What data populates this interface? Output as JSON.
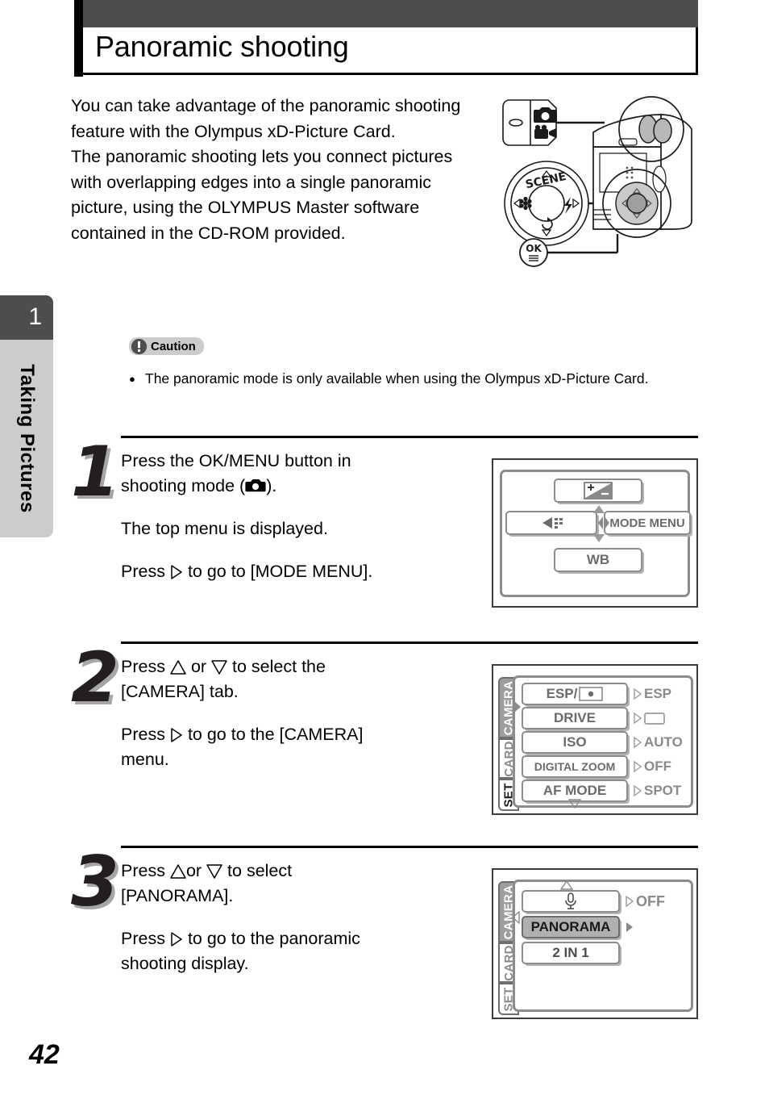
{
  "header": {
    "title": "Panoramic shooting"
  },
  "chapter_tab": {
    "number": "1",
    "name": "Taking Pictures"
  },
  "intro": {
    "paragraph": "You can take advantage of the panoramic shooting feature with the Olympus xD-Picture Card.\nThe panoramic shooting lets you connect pictures with overlapping edges into a single panoramic picture, using the OLYMPUS Master software contained in the CD-ROM provided."
  },
  "camera_diagram": {
    "mode_switch_labels": [
      "still-camera-icon",
      "movie-camera-icon"
    ],
    "arrow_pad_label": "SCENE",
    "arrow_pad_icons": [
      "macro-icon",
      "flash-icon",
      "selftimer-icon"
    ],
    "ok_button_label": "OK"
  },
  "caution": {
    "badge_label": "Caution",
    "icon": "exclamation-icon",
    "bullet": "●",
    "text": "The panoramic mode is only available when using the Olympus xD-Picture Card."
  },
  "steps": [
    {
      "number": "1",
      "lines": [
        "Press the OK/MENU button in shooting mode (",
        ").",
        "The top menu is displayed.",
        "Press",
        "to go to [MODE MENU]."
      ],
      "text_1_prefix": "Press the OK/MENU button in",
      "text_1_line2_a": "shooting mode (",
      "text_1_line2_b": ").",
      "text_2": "The top menu is displayed.",
      "text_3_a": "Press",
      "text_3_b": "to go to [MODE MENU].",
      "screen": {
        "type": "top-menu",
        "top_item": "exposure-compensation-icon",
        "left_item": "image-quality-icon",
        "right_item": "MODE MENU",
        "bottom_item": "WB"
      }
    },
    {
      "number": "2",
      "text_1_a": "Press",
      "text_1_b": "or",
      "text_1_c": "to select the",
      "text_1_d": "[CAMERA] tab.",
      "text_2_a": "Press",
      "text_2_b": "to go to the [CAMERA]",
      "text_2_c": "menu.",
      "screen": {
        "type": "mode-menu-camera",
        "tabs": [
          "CAMERA",
          "CARD",
          "SET"
        ],
        "active_tab": "CAMERA",
        "items": [
          {
            "label": "ESP/",
            "icon": "spot-metering-icon",
            "value": "ESP"
          },
          {
            "label": "DRIVE",
            "value": "",
            "value_icon": "single-frame-icon"
          },
          {
            "label": "ISO",
            "value": "AUTO"
          },
          {
            "label": "DIGITAL ZOOM",
            "value": "OFF"
          },
          {
            "label": "AF MODE",
            "value": "SPOT"
          }
        ],
        "scroll_down_icon": "triangle-down-icon"
      }
    },
    {
      "number": "3",
      "text_1_a": "Press",
      "text_1_b": "or",
      "text_1_c": "to select",
      "text_1_d": "[PANORAMA].",
      "text_2_a": "Press",
      "text_2_b": "to go to the panoramic",
      "text_2_c": "shooting display.",
      "screen": {
        "type": "mode-menu-camera-page2",
        "tabs": [
          "CAMERA",
          "CARD",
          "SET"
        ],
        "active_tab": "CAMERA",
        "scroll_up_icon": "triangle-up-icon",
        "items": [
          {
            "label": "",
            "icon": "microphone-icon",
            "value": "OFF"
          },
          {
            "label": "PANORAMA",
            "value": "",
            "selected": true
          },
          {
            "label": "2 IN 1",
            "value": ""
          }
        ]
      }
    }
  ],
  "page_number": "42",
  "colors": {
    "header_bar": "#4d4d4d",
    "accent_black": "#000000",
    "tab_gray": "#cccccc",
    "menu_gray": "#8a8a8a",
    "selected_gray": "#b0b0b0"
  }
}
